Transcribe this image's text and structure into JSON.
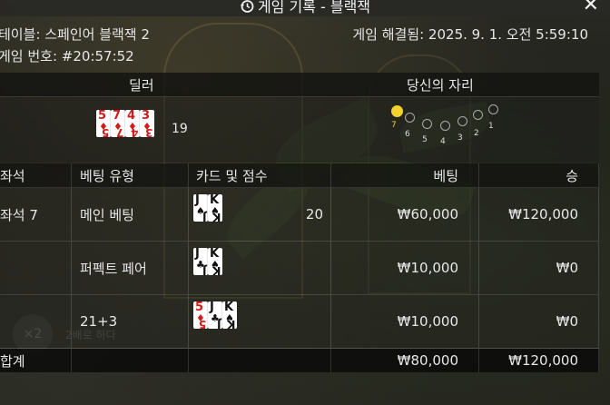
{
  "window": {
    "title": "게임 기록 - 블랙잭",
    "close_icon": "close-icon",
    "history_icon": "history-icon"
  },
  "info": {
    "table": "테이블: 스페인어 블랙잭 2",
    "game_number": "게임 번호: #20:57:52",
    "resolved": "게임 해결됨: 2025. 9. 1. 오전 5:59:10"
  },
  "headers": {
    "dealer": "딜러",
    "your_seat": "당신의 자리"
  },
  "dealer": {
    "cards": [
      {
        "rank": "5",
        "suit": "♦",
        "color": "red"
      },
      {
        "rank": "7",
        "suit": "♦",
        "color": "red"
      },
      {
        "rank": "4",
        "suit": "♦",
        "color": "red"
      },
      {
        "rank": "3",
        "suit": "♦",
        "color": "red"
      }
    ],
    "score": "19"
  },
  "seats": {
    "labels": [
      "7",
      "6",
      "5",
      "4",
      "3",
      "2",
      "1"
    ],
    "active": "7",
    "active_color": "#f2d22e"
  },
  "table": {
    "columns": [
      "좌석",
      "베팅 유형",
      "카드 및 점수",
      "베팅",
      "승"
    ],
    "rows": [
      {
        "seat": "좌석 7",
        "bet_type": "메인 베팅",
        "score": "20",
        "bet": "₩60,000",
        "win": "₩120,000",
        "cards": [
          {
            "rank": "J",
            "suit": "♠",
            "color": "black"
          },
          {
            "rank": "K",
            "suit": "♠",
            "color": "black"
          }
        ]
      },
      {
        "seat": "",
        "bet_type": "퍼펙트 페어",
        "score": "",
        "bet": "₩10,000",
        "win": "₩0",
        "cards": [
          {
            "rank": "J",
            "suit": "♣",
            "color": "black"
          },
          {
            "rank": "K",
            "suit": "♠",
            "color": "black"
          }
        ]
      },
      {
        "seat": "",
        "bet_type": "21+3",
        "score": "",
        "bet": "₩10,000",
        "win": "₩0",
        "cards": [
          {
            "rank": "5",
            "suit": "♦",
            "color": "red"
          },
          {
            "rank": "J",
            "suit": "♣",
            "color": "black"
          },
          {
            "rank": "K",
            "suit": "♠",
            "color": "black"
          }
        ]
      }
    ],
    "total": {
      "label": "합계",
      "bet": "₩80,000",
      "win": "₩120,000"
    }
  },
  "background": {
    "ghost_button": "×2",
    "ghost_label": "2배로 하다"
  }
}
